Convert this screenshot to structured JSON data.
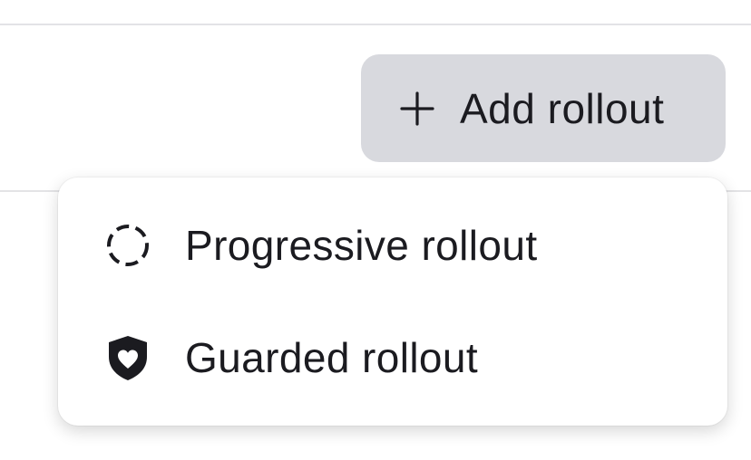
{
  "toolbar": {
    "add_rollout_label": "Add rollout"
  },
  "menu": {
    "items": [
      {
        "label": "Progressive rollout",
        "icon": "dashed-circle-icon"
      },
      {
        "label": "Guarded rollout",
        "icon": "shield-heart-icon"
      }
    ]
  },
  "colors": {
    "button_bg": "#d8d9de",
    "text": "#1b1b20",
    "divider": "#e3e3e6",
    "menu_bg": "#ffffff"
  }
}
